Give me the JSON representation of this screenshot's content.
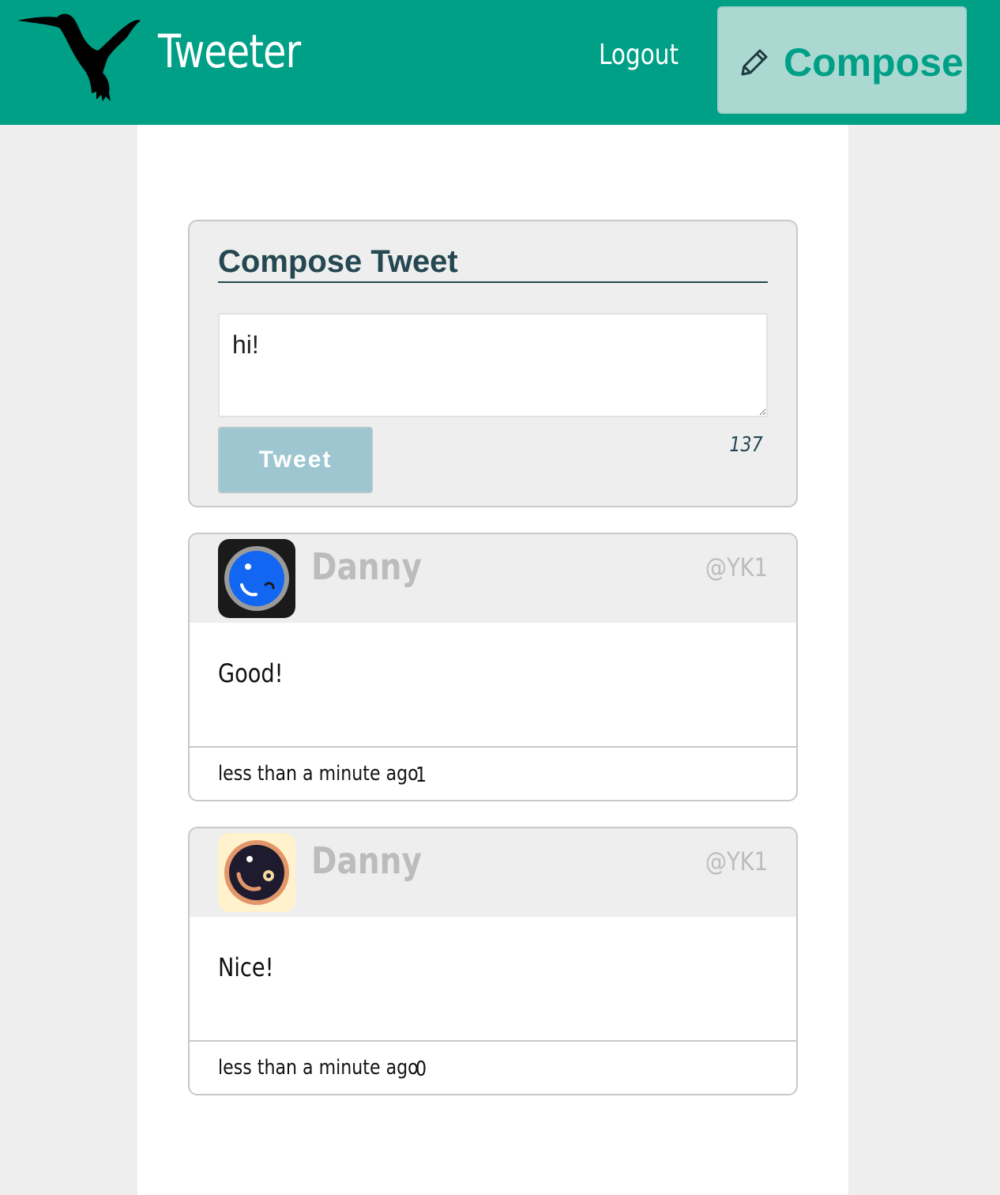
{
  "nav": {
    "brand": "Tweeter",
    "logout_label": "Logout",
    "compose_label": "Compose",
    "logo_icon": "hummingbird-logo",
    "compose_icon": "pencil-icon",
    "accent_color": "#00a087"
  },
  "compose": {
    "title": "Compose Tweet",
    "input_value": "hi!",
    "button_label": "Tweet",
    "char_counter": "137"
  },
  "tweets": [
    {
      "author": "Danny",
      "handle": "@YK1",
      "text": "Good!",
      "timestamp": "less than a minute ago",
      "count": "1",
      "avatar_icon": "blue-face-avatar"
    },
    {
      "author": "Danny",
      "handle": "@YK1",
      "text": "Nice!",
      "timestamp": "less than a minute ago",
      "count": "0",
      "avatar_icon": "orange-face-avatar"
    }
  ]
}
